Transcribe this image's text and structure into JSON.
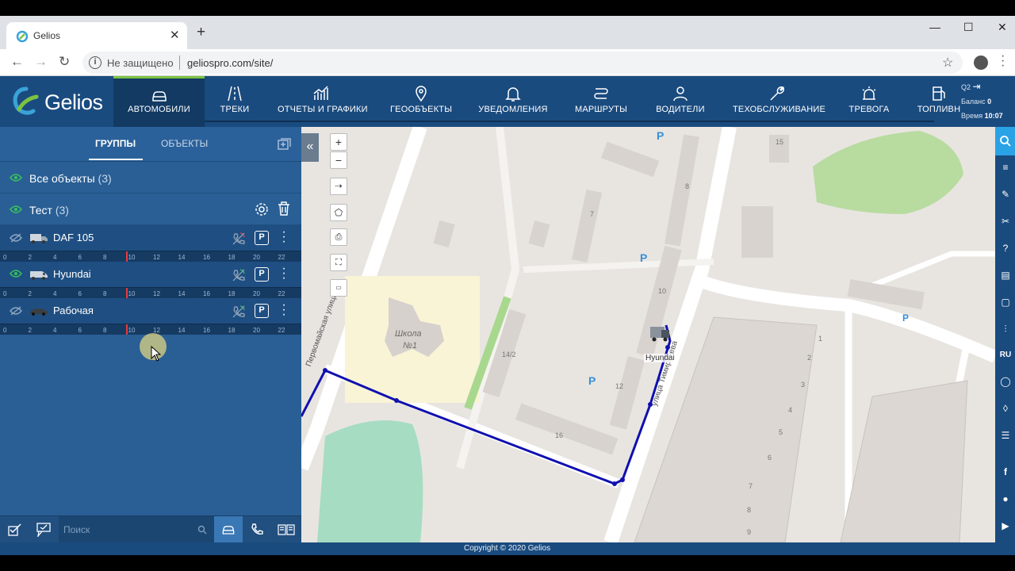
{
  "browser": {
    "tab_title": "Gelios",
    "security_label": "Не защищено",
    "url": "geliospro.com/site/"
  },
  "app": {
    "logo_text": "Gelios",
    "nav": [
      {
        "label": "АВТОМОБИЛИ",
        "icon": "car-icon",
        "active": true
      },
      {
        "label": "ТРЕКИ",
        "icon": "road-icon"
      },
      {
        "label": "ОТЧЕТЫ И ГРАФИКИ",
        "icon": "chart-icon"
      },
      {
        "label": "ГЕООБЪЕКТЫ",
        "icon": "map-pin-icon"
      },
      {
        "label": "УВЕДОМЛЕНИЯ",
        "icon": "bell-icon"
      },
      {
        "label": "МАРШРУТЫ",
        "icon": "route-icon"
      },
      {
        "label": "ВОДИТЕЛИ",
        "icon": "user-icon"
      },
      {
        "label": "ТЕХОБСЛУЖИВАНИЕ",
        "icon": "wrench-icon"
      },
      {
        "label": "ТРЕВОГА",
        "icon": "alarm-icon"
      },
      {
        "label": "ТОПЛИВН",
        "icon": "fuel-icon"
      }
    ],
    "account": {
      "user": "Q2",
      "balance_label": "Баланс",
      "balance_value": "0",
      "time_label": "Время",
      "time_value": "10:07"
    }
  },
  "panel": {
    "tabs": [
      "ГРУППЫ",
      "ОБЪЕКТЫ"
    ],
    "groups": [
      {
        "label": "Все объекты",
        "count": "(3)"
      },
      {
        "label": "Тест",
        "count": "(3)"
      }
    ],
    "objects": [
      {
        "name": "DAF 105"
      },
      {
        "name": "Hyundai"
      },
      {
        "name": "Рабочая"
      }
    ],
    "timeline_ticks": [
      "0",
      "2",
      "4",
      "6",
      "8",
      "10",
      "12",
      "14",
      "16",
      "18",
      "20",
      "22"
    ],
    "search_placeholder": "Поиск"
  },
  "map": {
    "vehicle_label": "Hyundai",
    "street_1": "Первомайская улица",
    "street_2": "улица Тимирязева",
    "school_label_1": "Школа",
    "school_label_2": "№1",
    "house_numbers": [
      "15",
      "8",
      "7",
      "10",
      "14/2",
      "12",
      "16",
      "1",
      "2",
      "3",
      "4",
      "5",
      "6",
      "7",
      "8",
      "9"
    ],
    "parking": "P"
  },
  "rightbar": {
    "lang": "RU"
  },
  "footer": {
    "copyright": "Copyright © 2020 Gelios"
  },
  "colors": {
    "header": "#1a4b7f",
    "panel": "#2a5f95",
    "accent_green": "#7cc242",
    "route": "#1010b0"
  }
}
